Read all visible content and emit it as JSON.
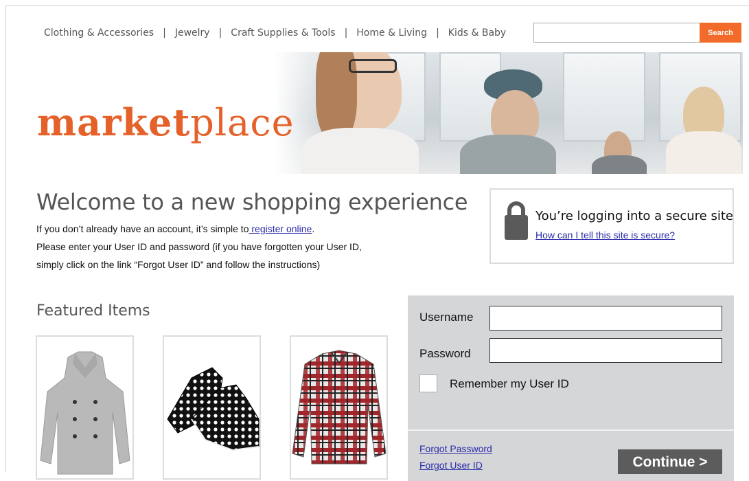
{
  "nav": {
    "items": [
      {
        "label": "Clothing & Accessories"
      },
      {
        "label": "Jewelry"
      },
      {
        "label": "Craft Supplies & Tools"
      },
      {
        "label": "Home & Living"
      },
      {
        "label": "Kids & Baby"
      }
    ],
    "separator": "|"
  },
  "search": {
    "placeholder": "",
    "value": "",
    "button_label": "Search"
  },
  "brand": {
    "bold": "market",
    "light": "place"
  },
  "welcome": {
    "title": "Welcome to a new shopping experience",
    "line1_prefix": "If you don’t already have an account, it’s simple to",
    "line1_link": " register online",
    "line1_suffix": ".",
    "line2": "Please enter your User ID and password (if you have forgotten your User ID,",
    "line3": "simply click on the link “Forgot User ID” and follow the instructions)"
  },
  "secure": {
    "title": "You’re logging into a secure site",
    "link": "How can I tell this site is secure?"
  },
  "featured": {
    "title": "Featured Items",
    "items": [
      {
        "icon": "gray-peacoat-image"
      },
      {
        "icon": "polka-dot-shoes-image"
      },
      {
        "icon": "plaid-shirt-image"
      }
    ]
  },
  "login": {
    "username_label": "Username",
    "password_label": "Password",
    "remember_label": "Remember my User ID",
    "forgot_password": "Forgot Password",
    "forgot_userid": "Forgot User ID",
    "continue_label": "Continue >"
  },
  "colors": {
    "accent": "#f26b2a",
    "brand": "#e4622a",
    "link": "#2a2aa8",
    "panel": "#d5d6d8",
    "button": "#5c5c5c"
  }
}
